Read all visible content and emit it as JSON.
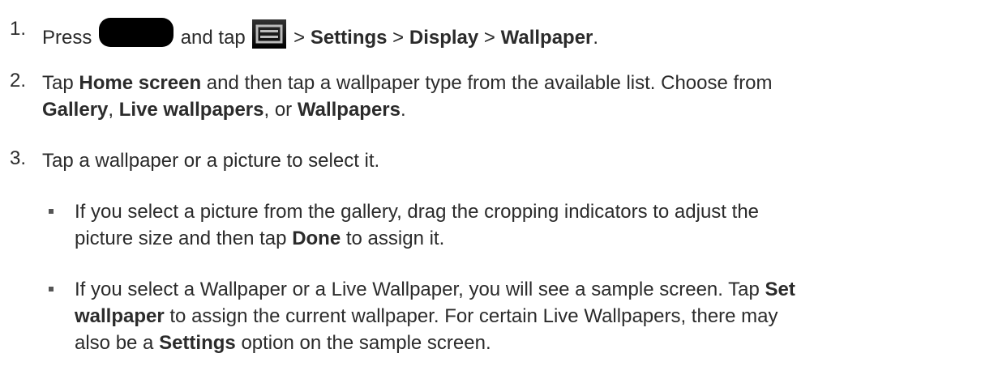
{
  "step1": {
    "number": "1.",
    "press": "Press",
    "and_tap": "and tap",
    "sep1": ">",
    "settings": "Settings",
    "sep2": ">",
    "display": "Display",
    "sep3": ">",
    "wallpaper": "Wallpaper",
    "end": "."
  },
  "step2": {
    "number": "2.",
    "tap": "Tap",
    "home_screen": "Home screen",
    "rest1": "and then tap a wallpaper type from the available list. Choose from",
    "gallery": "Gallery",
    "comma1": ",",
    "live_wallpapers": "Live wallpapers",
    "or": ", or",
    "wallpapers": "Wallpapers",
    "end": "."
  },
  "step3": {
    "number": "3.",
    "text": "Tap a wallpaper or a picture to select it."
  },
  "bullet1": {
    "line1": "If you select a picture from the gallery, drag the cropping indicators to adjust the",
    "line2a": "picture size and then tap",
    "done": "Done",
    "line2b": "to assign it."
  },
  "bullet2": {
    "line1a": "If you select a Wallpaper or a Live Wallpaper, you will see a sample screen. Tap",
    "set": "Set",
    "wallpaper": "wallpaper",
    "line2b": "to assign the current wallpaper. For certain Live Wallpapers, there may",
    "line3a": "also be a",
    "settings": "Settings",
    "line3b": "option on the sample screen."
  },
  "icons": {
    "home_button": "home-button-icon",
    "menu_key": "menu-key-icon"
  }
}
